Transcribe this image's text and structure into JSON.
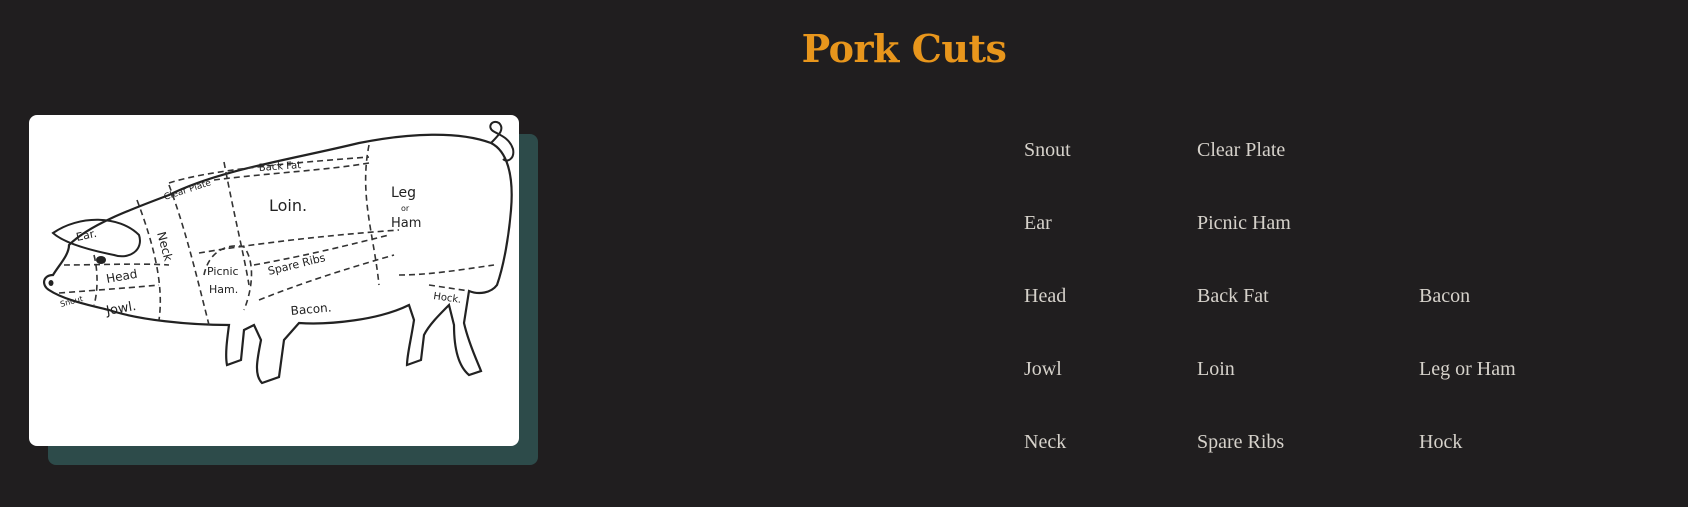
{
  "page": {
    "title": "Pork Cuts",
    "title_color": "#e8961c",
    "background": "#201e1f",
    "card_shadow_color": "#2d4b4a"
  },
  "diagram": {
    "labels": {
      "ear": "Ear.",
      "head": "Head",
      "snout": "Snout",
      "jowl": "Jowl.",
      "neck": "Neck",
      "clear_plate": "Clear Plate",
      "back_fat": "Back Fat",
      "loin": "Loin.",
      "leg": "Leg",
      "or": "or",
      "ham": "Ham",
      "picnic": "Picnic",
      "picnic_ham": "Ham.",
      "spare_ribs": "Spare Ribs",
      "bacon": "Bacon.",
      "hock": "Hock."
    }
  },
  "cuts": {
    "col1": [
      "Snout",
      "Ear",
      "Head",
      "Jowl",
      "Neck"
    ],
    "col2": [
      "Clear Plate",
      "Picnic Ham",
      "Back Fat",
      "Loin",
      "Spare Ribs"
    ],
    "col3": [
      "Bacon",
      "Leg or Ham",
      "Hock"
    ]
  }
}
